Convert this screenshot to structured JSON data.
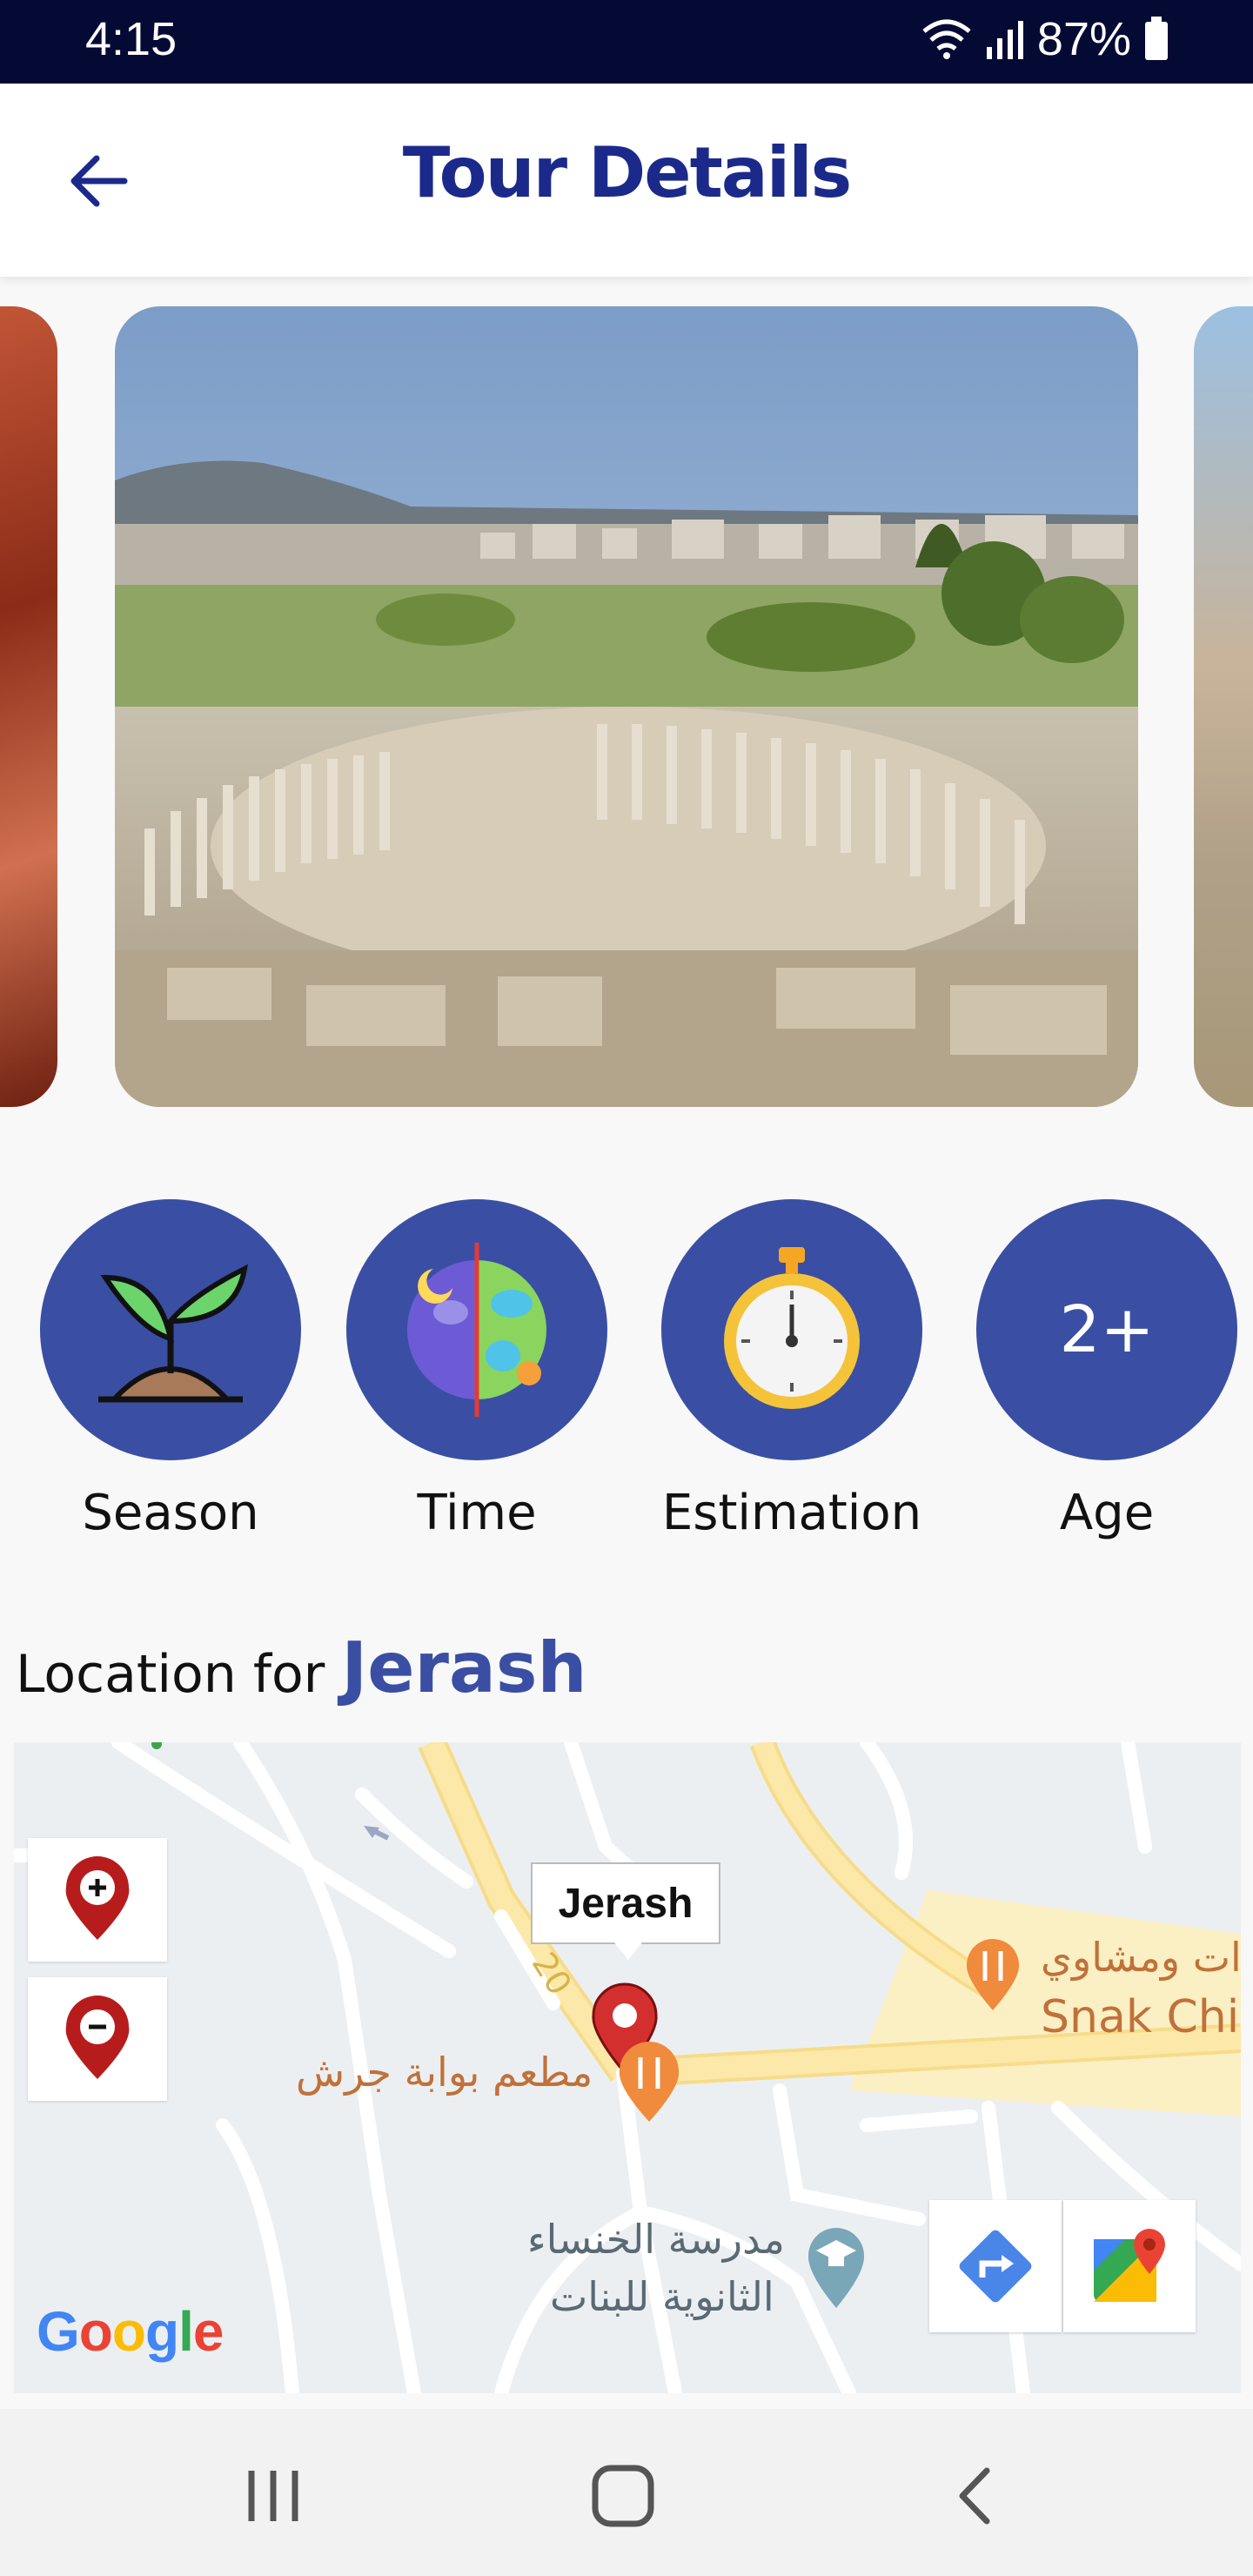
{
  "status_bar": {
    "time": "4:15",
    "battery": "87%"
  },
  "app_bar": {
    "title": "Tour Details"
  },
  "features": {
    "season_label": "Season",
    "time_label": "Time",
    "estimation_label": "Estimation",
    "age_label": "Age",
    "age_value": "2+"
  },
  "location": {
    "prefix": "Location for ",
    "place": "Jerash"
  },
  "map": {
    "marker_label": "Jerash",
    "road_number": "20",
    "restaurant_ar": "مطعم بوابة جرش",
    "snack_ar": "ات ومشاوي",
    "snack_en": "Snak Chik",
    "school_ar_line1": "مدرسة الخنساء",
    "school_ar_line2": "الثانوية للبنات",
    "logo": "Google",
    "colors": {
      "marker": "#d32f2f",
      "poi": "#f08a3c",
      "road": "#fbe9a6"
    }
  },
  "theme": {
    "primary": "#3a4fa3",
    "title": "#1b2a8a",
    "status_bar": "#050a35"
  }
}
